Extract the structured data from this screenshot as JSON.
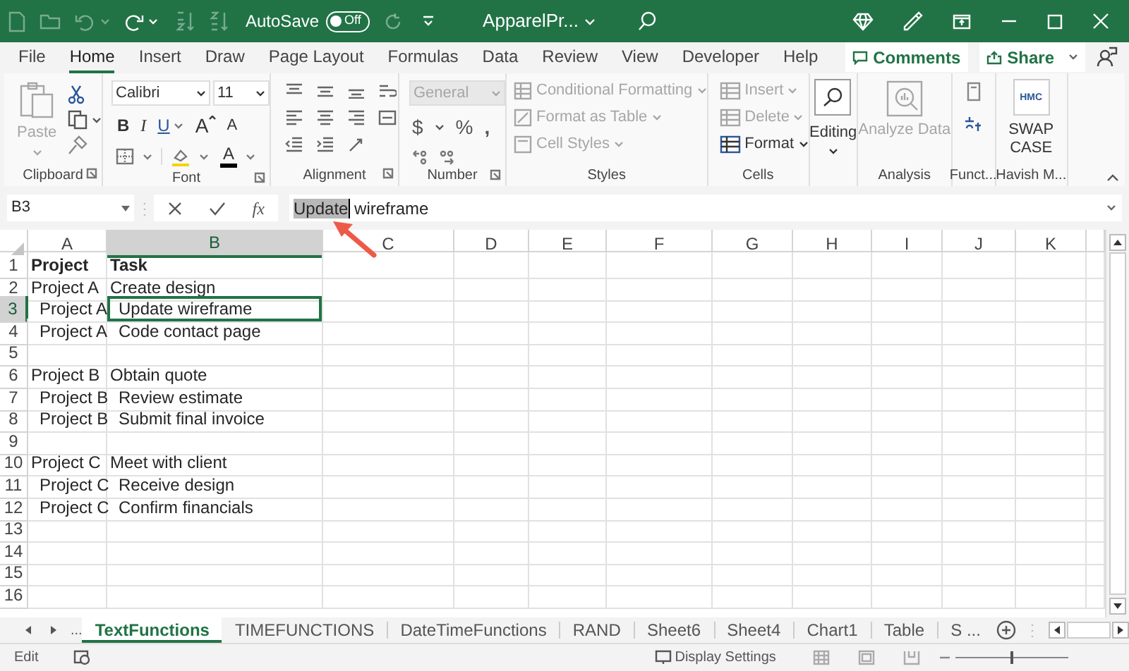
{
  "title_bar": {
    "autosave_label": "AutoSave",
    "autosave_toggle": {
      "label": "Off",
      "on": false
    },
    "file_name": "ApparelPr..."
  },
  "ribbon_tabs": [
    {
      "label": "File",
      "selected": false
    },
    {
      "label": "Home",
      "selected": true
    },
    {
      "label": "Insert",
      "selected": false
    },
    {
      "label": "Draw",
      "selected": false
    },
    {
      "label": "Page Layout",
      "selected": false
    },
    {
      "label": "Formulas",
      "selected": false
    },
    {
      "label": "Data",
      "selected": false
    },
    {
      "label": "Review",
      "selected": false
    },
    {
      "label": "View",
      "selected": false
    },
    {
      "label": "Developer",
      "selected": false
    },
    {
      "label": "Help",
      "selected": false
    }
  ],
  "comments_button": "Comments",
  "share_button": "Share",
  "ribbon_groups": [
    {
      "kind": "clipboard",
      "label": "Clipboard",
      "paste": {
        "label": "Paste",
        "disabled": true
      }
    },
    {
      "kind": "font",
      "label": "Font",
      "font_name": "Calibri",
      "font_size": "11",
      "bold": "B",
      "italic": "I",
      "underline": "U",
      "grow": "A",
      "shrink": "A",
      "font_color": "A"
    },
    {
      "kind": "alignment",
      "label": "Alignment"
    },
    {
      "kind": "number",
      "label": "Number",
      "format": {
        "value": "General",
        "disabled": true
      },
      "currency": "$",
      "percent": "%",
      "comma": ","
    },
    {
      "kind": "styles",
      "label": "Styles",
      "items": [
        {
          "label": "Conditional Formatting",
          "disabled": true
        },
        {
          "label": "Format as Table",
          "disabled": true
        },
        {
          "label": "Cell Styles",
          "disabled": true
        }
      ]
    },
    {
      "kind": "cells",
      "label": "Cells",
      "items": [
        {
          "label": "Insert",
          "disabled": true
        },
        {
          "label": "Delete",
          "disabled": true
        },
        {
          "label": "Format",
          "disabled": false
        }
      ]
    },
    {
      "kind": "editing",
      "button": "Editing"
    },
    {
      "kind": "analysis",
      "label": "Analysis",
      "button": {
        "label": "Analyze Data",
        "disabled": true
      }
    },
    {
      "kind": "functions",
      "label": "Funct..."
    },
    {
      "kind": "addin",
      "label": "Havish M...",
      "logo": "HMC",
      "button": "SWAP CASE"
    }
  ],
  "formula_bar": {
    "name_box": "B3",
    "function_label": "fx",
    "selected_text": "Update",
    "rest_text": "wireframe"
  },
  "columns": [
    {
      "label": "A",
      "selected": false
    },
    {
      "label": "B",
      "selected": true
    },
    {
      "label": "C",
      "selected": false
    },
    {
      "label": "D",
      "selected": false
    },
    {
      "label": "E",
      "selected": false
    },
    {
      "label": "F",
      "selected": false
    },
    {
      "label": "G",
      "selected": false
    },
    {
      "label": "H",
      "selected": false
    },
    {
      "label": "I",
      "selected": false
    },
    {
      "label": "J",
      "selected": false
    },
    {
      "label": "K",
      "selected": false
    }
  ],
  "rows": [
    {
      "header": "1",
      "selected": false,
      "cells": [
        {
          "text": "Project",
          "bold": true,
          "indented": false,
          "selected": false
        },
        {
          "text": "Task",
          "bold": true,
          "indented": false,
          "selected": false
        }
      ]
    },
    {
      "header": "2",
      "selected": false,
      "cells": [
        {
          "text": "Project A",
          "bold": false,
          "indented": false,
          "selected": false
        },
        {
          "text": "Create design",
          "bold": false,
          "indented": false,
          "selected": false
        }
      ]
    },
    {
      "header": "3",
      "selected": true,
      "cells": [
        {
          "text": "Project A",
          "bold": false,
          "indented": true,
          "selected": false
        },
        {
          "text": "Update wireframe",
          "bold": false,
          "indented": true,
          "selected": true
        }
      ]
    },
    {
      "header": "4",
      "selected": false,
      "cells": [
        {
          "text": "Project A",
          "bold": false,
          "indented": true,
          "selected": false
        },
        {
          "text": "Code contact page",
          "bold": false,
          "indented": true,
          "selected": false
        }
      ]
    },
    {
      "header": "5",
      "selected": false,
      "cells": []
    },
    {
      "header": "6",
      "selected": false,
      "cells": [
        {
          "text": "Project B",
          "bold": false,
          "indented": false,
          "selected": false
        },
        {
          "text": "Obtain quote",
          "bold": false,
          "indented": false,
          "selected": false
        }
      ]
    },
    {
      "header": "7",
      "selected": false,
      "cells": [
        {
          "text": "Project B",
          "bold": false,
          "indented": true,
          "selected": false
        },
        {
          "text": "Review estimate",
          "bold": false,
          "indented": true,
          "selected": false
        }
      ]
    },
    {
      "header": "8",
      "selected": false,
      "cells": [
        {
          "text": "Project B",
          "bold": false,
          "indented": true,
          "selected": false
        },
        {
          "text": "Submit final invoice",
          "bold": false,
          "indented": true,
          "selected": false
        }
      ]
    },
    {
      "header": "9",
      "selected": false,
      "cells": []
    },
    {
      "header": "10",
      "selected": false,
      "cells": [
        {
          "text": "Project C",
          "bold": false,
          "indented": false,
          "selected": false
        },
        {
          "text": "Meet with client",
          "bold": false,
          "indented": false,
          "selected": false
        }
      ]
    },
    {
      "header": "11",
      "selected": false,
      "cells": [
        {
          "text": "Project C",
          "bold": false,
          "indented": true,
          "selected": false
        },
        {
          "text": "Receive design",
          "bold": false,
          "indented": true,
          "selected": false
        }
      ]
    },
    {
      "header": "12",
      "selected": false,
      "cells": [
        {
          "text": "Project C",
          "bold": false,
          "indented": true,
          "selected": false
        },
        {
          "text": "Confirm financials",
          "bold": false,
          "indented": true,
          "selected": false
        }
      ]
    },
    {
      "header": "13",
      "selected": false,
      "cells": []
    },
    {
      "header": "14",
      "selected": false,
      "cells": []
    },
    {
      "header": "15",
      "selected": false,
      "cells": []
    },
    {
      "header": "16",
      "selected": false,
      "cells": []
    }
  ],
  "sheet_tabs": [
    {
      "label": "TextFunctions",
      "selected": true
    },
    {
      "label": "TIMEFUNCTIONS",
      "selected": false
    },
    {
      "label": "DateTimeFunctions",
      "selected": false
    },
    {
      "label": "RAND",
      "selected": false
    },
    {
      "label": "Sheet6",
      "selected": false
    },
    {
      "label": "Sheet4",
      "selected": false
    },
    {
      "label": "Chart1",
      "selected": false
    },
    {
      "label": "Table",
      "selected": false
    },
    {
      "label": "S ...",
      "selected": false
    }
  ],
  "sheet_nav_more": "...",
  "status_bar": {
    "mode": "Edit",
    "display_settings": "Display Settings",
    "zoom": {
      "level": 0.5
    }
  }
}
